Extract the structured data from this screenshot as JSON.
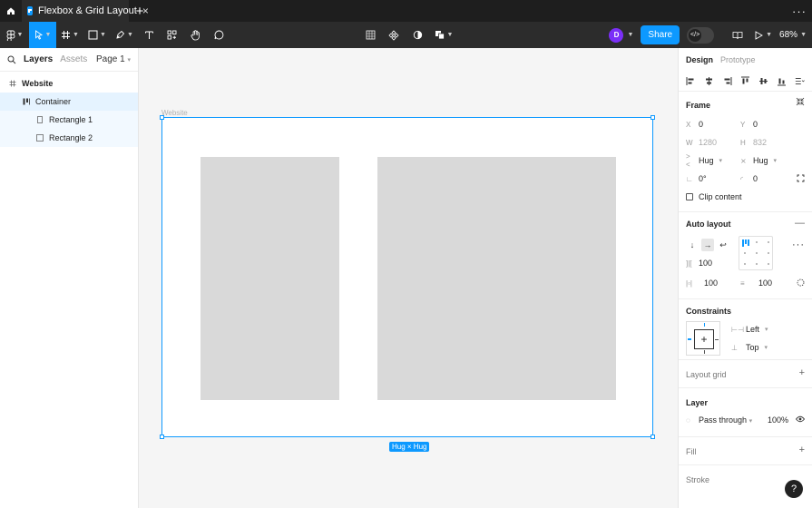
{
  "titlebar": {
    "tab_title": "Flexbox & Grid Layout",
    "close_glyph": "×",
    "new_tab_glyph": "+",
    "more_glyph": "···"
  },
  "toolbar": {
    "avatar_initial": "D",
    "share_label": "Share",
    "zoom_level": "68%"
  },
  "left_panel": {
    "tabs": [
      "Layers",
      "Assets"
    ],
    "page_selector": "Page 1",
    "layers": [
      {
        "name": "Website",
        "icon": "frame-icon"
      },
      {
        "name": "Container",
        "icon": "auto-layout-icon"
      },
      {
        "name": "Rectangle 1",
        "icon": "rectangle-icon"
      },
      {
        "name": "Rectangle 2",
        "icon": "rectangle-icon"
      }
    ]
  },
  "canvas": {
    "frame_label": "Website",
    "size_badge": "Hug × Hug"
  },
  "right_panel": {
    "tabs": [
      "Design",
      "Prototype"
    ],
    "frame": {
      "title": "Frame",
      "x_label": "X",
      "x": "0",
      "y_label": "Y",
      "y": "0",
      "w_label": "W",
      "w": "1280",
      "h_label": "H",
      "h": "832",
      "width_mode": "Hug",
      "height_mode": "Hug",
      "rotation": "0°",
      "corner_radius": "0",
      "clip_content": "Clip content"
    },
    "auto_layout": {
      "title": "Auto layout",
      "gap": "100",
      "padding_horizontal": "100",
      "padding_vertical": "100"
    },
    "constraints": {
      "title": "Constraints",
      "horizontal": "Left",
      "vertical": "Top"
    },
    "layout_grid": {
      "title": "Layout grid"
    },
    "layer": {
      "title": "Layer",
      "blend_mode": "Pass through",
      "opacity": "100%"
    },
    "fill": {
      "title": "Fill"
    },
    "stroke": {
      "title": "Stroke"
    }
  },
  "help": {
    "label": "?"
  },
  "colors": {
    "accent": "#0d99ff",
    "avatar": "#7b2ff7",
    "rect_fill": "#d9d9d9"
  }
}
